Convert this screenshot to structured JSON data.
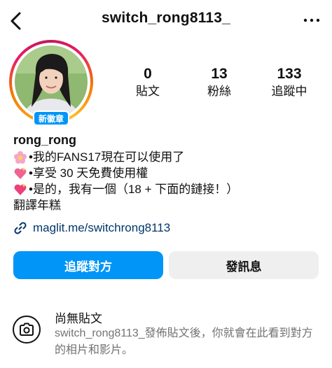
{
  "header": {
    "username": "switch_rong8113_"
  },
  "profile": {
    "badge": "新徽章",
    "display_name": "rong_rong",
    "stats": [
      {
        "value": "0",
        "label": "貼文"
      },
      {
        "value": "13",
        "label": "粉絲"
      },
      {
        "value": "133",
        "label": "追蹤中"
      }
    ],
    "bio": [
      {
        "icon": "flower-emoji",
        "text": "•我的FANS17現在可以使用了"
      },
      {
        "icon": "sparkle-heart-emoji",
        "text": "•享受 30 天免費使用權"
      },
      {
        "icon": "sparkle-heart-emoji",
        "text": "•是的，我有一個（18 + 下面的鏈接！）"
      }
    ],
    "translate_label": "翻譯年糕",
    "link": "maglit.me/switchrong8113"
  },
  "actions": {
    "follow_label": "追蹤對方",
    "message_label": "發訊息"
  },
  "empty_state": {
    "title": "尚無貼文",
    "text": "switch_rong8113_發佈貼文後，你就會在此看到對方的相片和影片。"
  }
}
